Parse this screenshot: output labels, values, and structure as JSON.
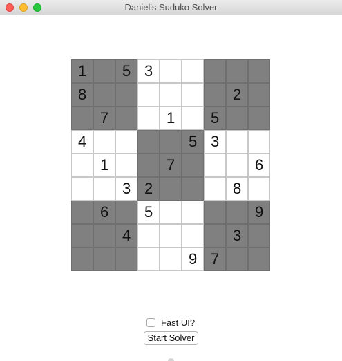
{
  "window": {
    "title": "Daniel's Suduko Solver"
  },
  "colors": {
    "shaded_cell": "#808080",
    "plain_cell": "#ffffff"
  },
  "board": {
    "rows": [
      {
        "cells": [
          {
            "value": "1",
            "shaded": true
          },
          {
            "value": "",
            "shaded": true
          },
          {
            "value": "5",
            "shaded": true
          },
          {
            "value": "3",
            "shaded": false
          },
          {
            "value": "",
            "shaded": false
          },
          {
            "value": "",
            "shaded": false
          },
          {
            "value": "",
            "shaded": true
          },
          {
            "value": "",
            "shaded": true
          },
          {
            "value": "",
            "shaded": true
          }
        ]
      },
      {
        "cells": [
          {
            "value": "8",
            "shaded": true
          },
          {
            "value": "",
            "shaded": true
          },
          {
            "value": "",
            "shaded": true
          },
          {
            "value": "",
            "shaded": false
          },
          {
            "value": "",
            "shaded": false
          },
          {
            "value": "",
            "shaded": false
          },
          {
            "value": "",
            "shaded": true
          },
          {
            "value": "2",
            "shaded": true
          },
          {
            "value": "",
            "shaded": true
          }
        ]
      },
      {
        "cells": [
          {
            "value": "",
            "shaded": true
          },
          {
            "value": "7",
            "shaded": true
          },
          {
            "value": "",
            "shaded": true
          },
          {
            "value": "",
            "shaded": false
          },
          {
            "value": "1",
            "shaded": false
          },
          {
            "value": "",
            "shaded": false
          },
          {
            "value": "5",
            "shaded": true
          },
          {
            "value": "",
            "shaded": true
          },
          {
            "value": "",
            "shaded": true
          }
        ]
      },
      {
        "cells": [
          {
            "value": "4",
            "shaded": false
          },
          {
            "value": "",
            "shaded": false
          },
          {
            "value": "",
            "shaded": false
          },
          {
            "value": "",
            "shaded": true
          },
          {
            "value": "",
            "shaded": true
          },
          {
            "value": "5",
            "shaded": true
          },
          {
            "value": "3",
            "shaded": false
          },
          {
            "value": "",
            "shaded": false
          },
          {
            "value": "",
            "shaded": false
          }
        ]
      },
      {
        "cells": [
          {
            "value": "",
            "shaded": false
          },
          {
            "value": "1",
            "shaded": false
          },
          {
            "value": "",
            "shaded": false
          },
          {
            "value": "",
            "shaded": true
          },
          {
            "value": "7",
            "shaded": true
          },
          {
            "value": "",
            "shaded": true
          },
          {
            "value": "",
            "shaded": false
          },
          {
            "value": "",
            "shaded": false
          },
          {
            "value": "6",
            "shaded": false
          }
        ]
      },
      {
        "cells": [
          {
            "value": "",
            "shaded": false
          },
          {
            "value": "",
            "shaded": false
          },
          {
            "value": "3",
            "shaded": false
          },
          {
            "value": "2",
            "shaded": true
          },
          {
            "value": "",
            "shaded": true
          },
          {
            "value": "",
            "shaded": true
          },
          {
            "value": "",
            "shaded": false
          },
          {
            "value": "8",
            "shaded": false
          },
          {
            "value": "",
            "shaded": false
          }
        ]
      },
      {
        "cells": [
          {
            "value": "",
            "shaded": true
          },
          {
            "value": "6",
            "shaded": true
          },
          {
            "value": "",
            "shaded": true
          },
          {
            "value": "5",
            "shaded": false
          },
          {
            "value": "",
            "shaded": false
          },
          {
            "value": "",
            "shaded": false
          },
          {
            "value": "",
            "shaded": true
          },
          {
            "value": "",
            "shaded": true
          },
          {
            "value": "9",
            "shaded": true
          }
        ]
      },
      {
        "cells": [
          {
            "value": "",
            "shaded": true
          },
          {
            "value": "",
            "shaded": true
          },
          {
            "value": "4",
            "shaded": true
          },
          {
            "value": "",
            "shaded": false
          },
          {
            "value": "",
            "shaded": false
          },
          {
            "value": "",
            "shaded": false
          },
          {
            "value": "",
            "shaded": true
          },
          {
            "value": "3",
            "shaded": true
          },
          {
            "value": "",
            "shaded": true
          }
        ]
      },
      {
        "cells": [
          {
            "value": "",
            "shaded": true
          },
          {
            "value": "",
            "shaded": true
          },
          {
            "value": "",
            "shaded": true
          },
          {
            "value": "",
            "shaded": false
          },
          {
            "value": "",
            "shaded": false
          },
          {
            "value": "9",
            "shaded": false
          },
          {
            "value": "7",
            "shaded": true
          },
          {
            "value": "",
            "shaded": true
          },
          {
            "value": "",
            "shaded": true
          }
        ]
      }
    ]
  },
  "controls": {
    "fast_ui_label": "Fast UI?",
    "fast_ui_checked": false,
    "start_button_label": "Start Solver"
  },
  "icons": {
    "close": "close-icon",
    "minimize": "minimize-icon",
    "zoom": "zoom-icon"
  }
}
